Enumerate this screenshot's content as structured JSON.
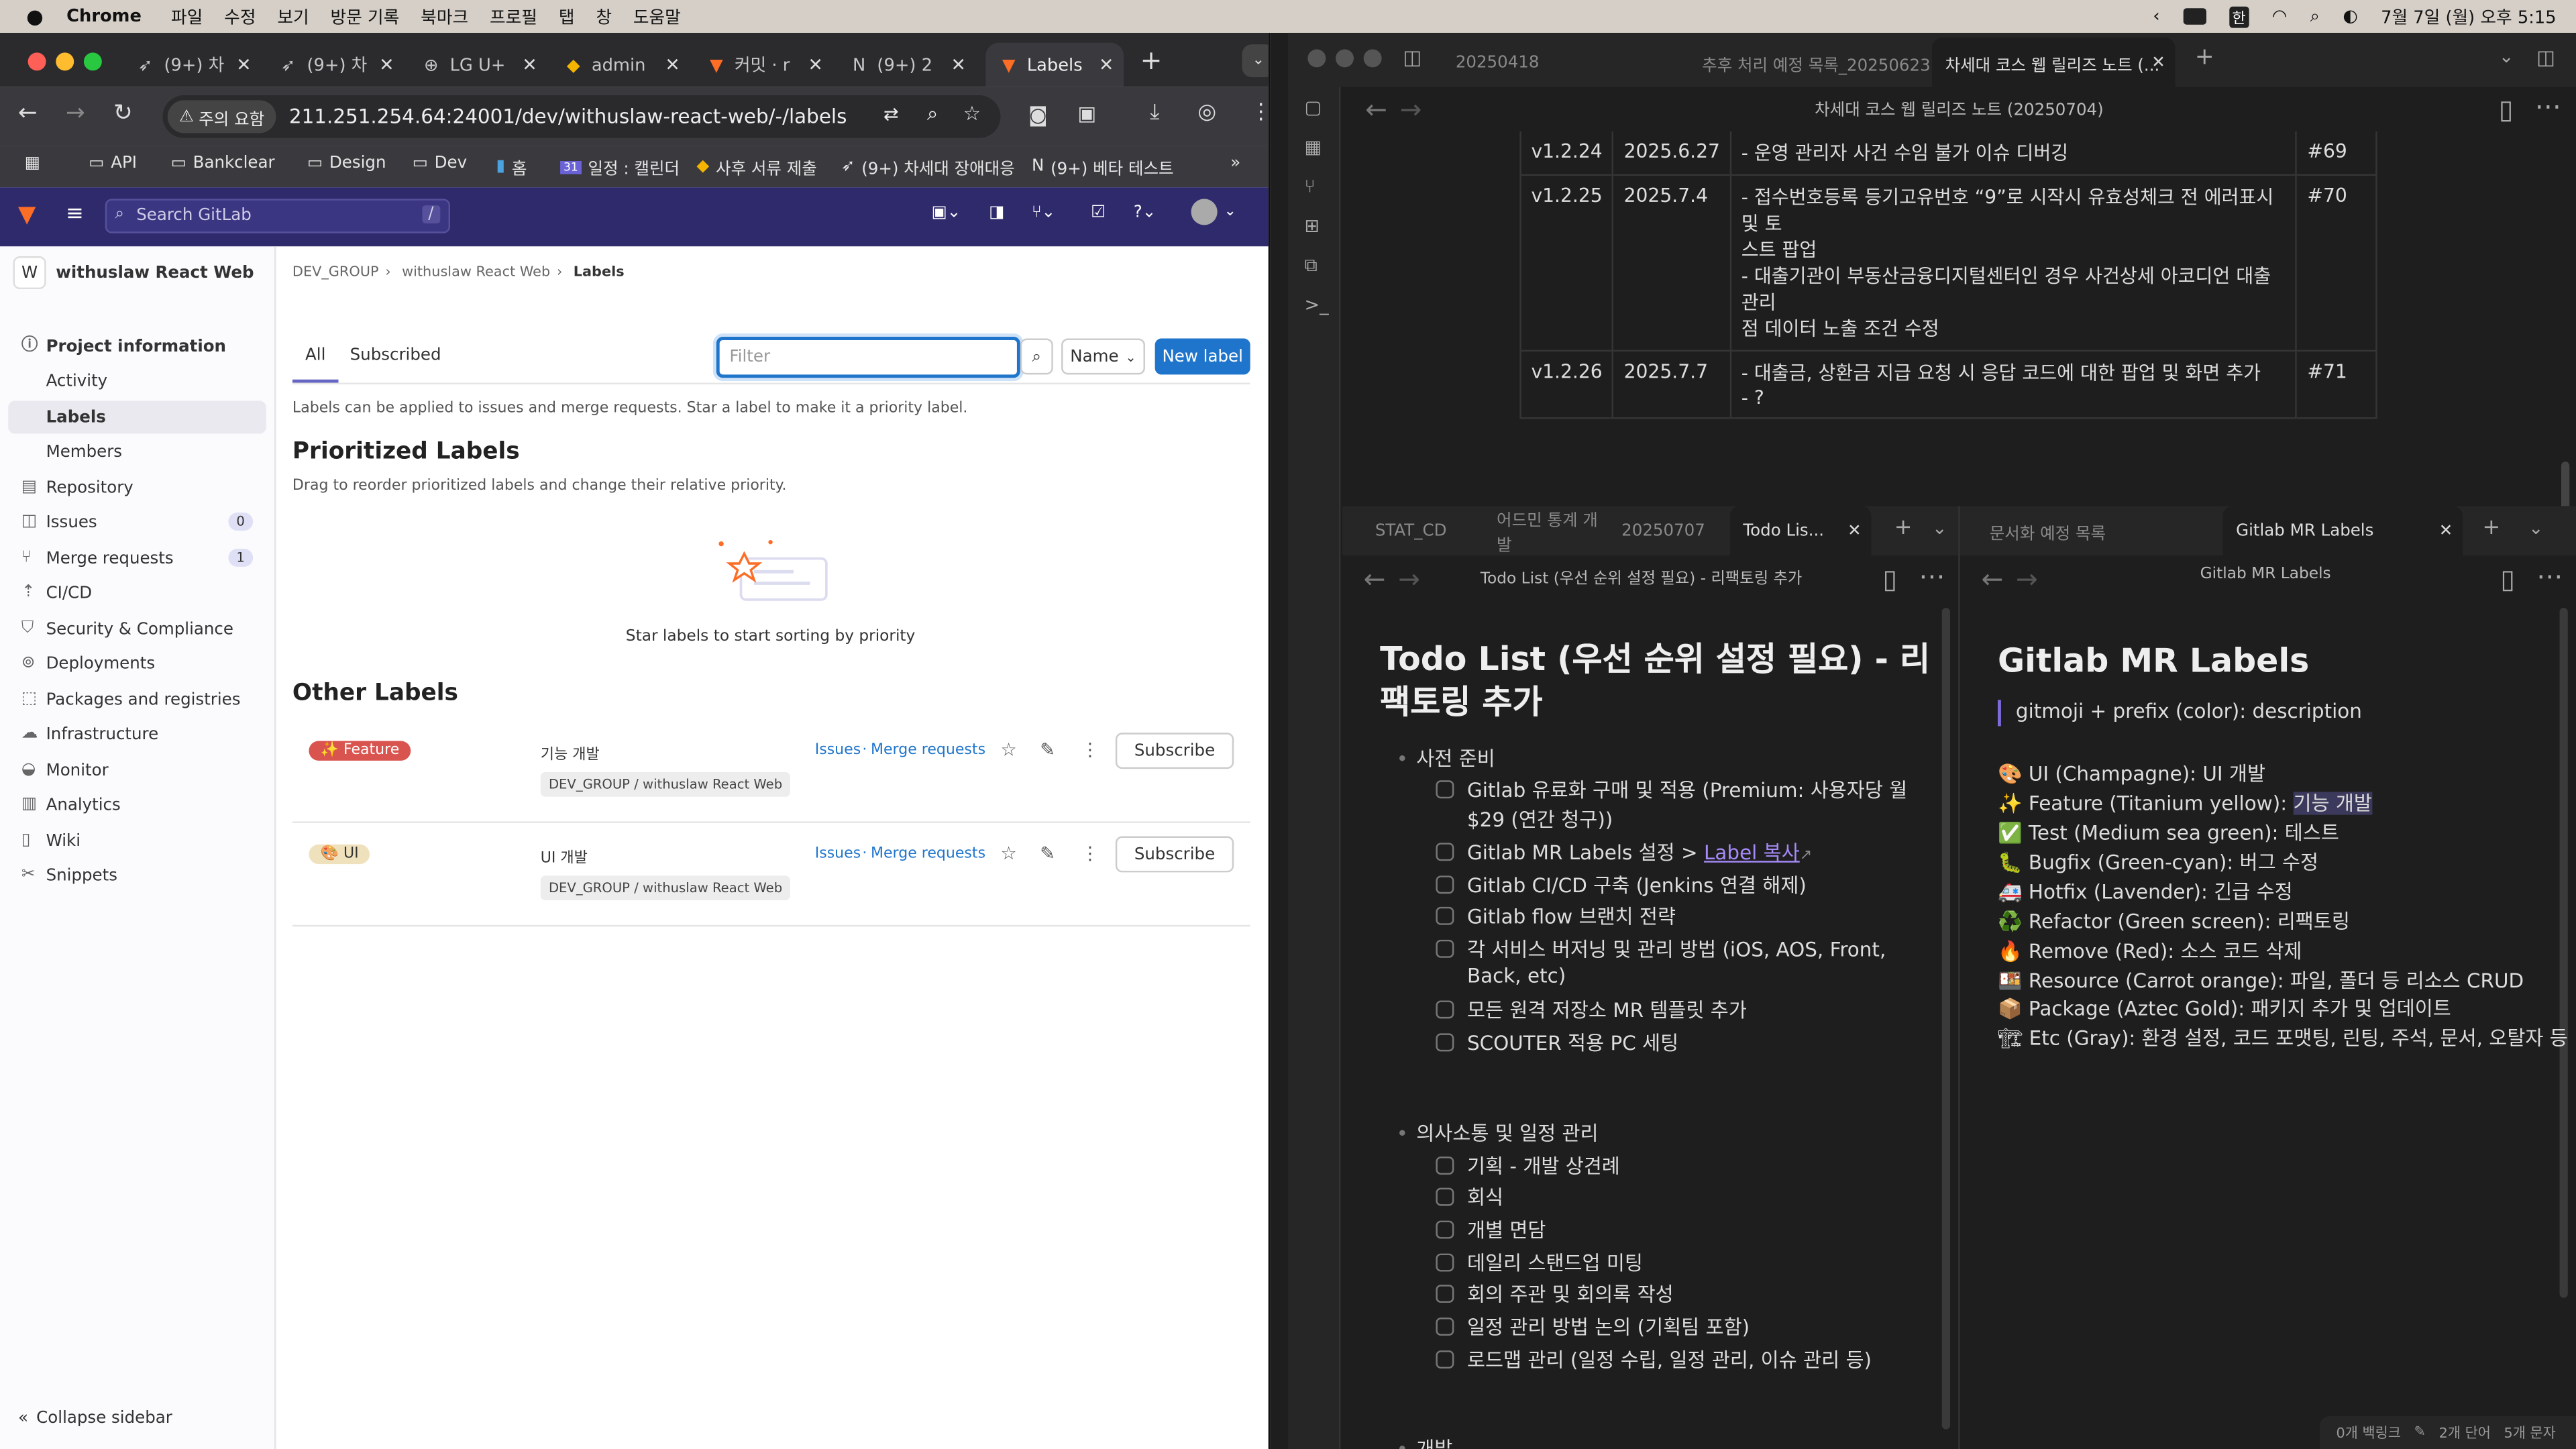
{
  "menubar": {
    "app": "Chrome",
    "items": [
      "파일",
      "수정",
      "보기",
      "방문 기록",
      "북마크",
      "프로필",
      "탭",
      "창",
      "도움말"
    ],
    "clock": "7월 7일 (월) 오후 5:15",
    "input": "한"
  },
  "chrome": {
    "tabs": [
      "(9+) 차",
      "(9+) 차",
      "LG U+",
      "admin",
      "커밋 · r",
      "(9+) 2",
      "Labels"
    ],
    "url": "211.251.254.64:24001/dev/withuslaw-react-web/-/labels",
    "security": "주의 요함",
    "bookmarks": [
      "API",
      "Bankclear",
      "Design",
      "Dev",
      "홈",
      "일정 : 캘린더",
      "사후 서류 제출",
      "(9+) 차세대 장애대응",
      "(9+) 베타 테스트"
    ]
  },
  "gitlab": {
    "search_placeholder": "Search GitLab",
    "search_key": "/",
    "project_initial": "W",
    "project": "withuslaw React Web",
    "nav": [
      {
        "label": "Project information",
        "icon": "info-icon",
        "bold": true
      },
      {
        "label": "Activity"
      },
      {
        "label": "Labels",
        "active": true
      },
      {
        "label": "Members"
      },
      {
        "label": "Repository",
        "icon": "book-icon"
      },
      {
        "label": "Issues",
        "icon": "issues-icon",
        "count": "0"
      },
      {
        "label": "Merge requests",
        "icon": "merge-icon",
        "count": "1"
      },
      {
        "label": "CI/CD",
        "icon": "rocket-icon"
      },
      {
        "label": "Security & Compliance",
        "icon": "shield-icon"
      },
      {
        "label": "Deployments",
        "icon": "deploy-icon"
      },
      {
        "label": "Packages and registries",
        "icon": "package-icon"
      },
      {
        "label": "Infrastructure",
        "icon": "cloud-icon"
      },
      {
        "label": "Monitor",
        "icon": "monitor-icon"
      },
      {
        "label": "Analytics",
        "icon": "chart-icon"
      },
      {
        "label": "Wiki",
        "icon": "wiki-icon"
      },
      {
        "label": "Snippets",
        "icon": "snippet-icon"
      }
    ],
    "collapse": "Collapse sidebar",
    "breadcrumb": [
      "DEV_GROUP",
      "withuslaw React Web",
      "Labels"
    ],
    "tabs": [
      "All",
      "Subscribed"
    ],
    "filter_placeholder": "Filter",
    "sort": "Name",
    "new_label": "New label",
    "intro": "Labels can be applied to issues and merge requests. Star a label to make it a priority label.",
    "prioritized_title": "Prioritized Labels",
    "prioritized_desc": "Drag to reorder prioritized labels and change their relative priority.",
    "empty_text": "Star labels to start sorting by priority",
    "other_title": "Other Labels",
    "labels": [
      {
        "name": "✨ Feature",
        "desc": "기능 개발",
        "group": "DEV_GROUP / withuslaw React Web",
        "color": "#d9534f",
        "text_color": "#ffffff"
      },
      {
        "name": "🎨 UI",
        "desc": "UI 개발",
        "group": "DEV_GROUP / withuslaw React Web",
        "color": "#f0e1bd",
        "text_color": "#333333"
      }
    ],
    "links_issues": "Issues",
    "links_sep": " · ",
    "links_mr": "Merge requests",
    "subscribe": "Subscribe"
  },
  "obsidian": {
    "top_tabs": [
      "20250418",
      "추후 처리 예정 목록_20250623",
      "차세대 코스 웹 릴리즈 노트 (..."
    ],
    "top_title": "차세대 코스 웹 릴리즈 노트 (20250704)",
    "release_rows": [
      {
        "ver": "v1.2.24",
        "date": "2025.6.27",
        "lines": [
          "- 운영 관리자 사건 수임 불가 이슈 디버깅"
        ],
        "ref": "#69"
      },
      {
        "ver": "v1.2.25",
        "date": "2025.7.4",
        "lines": [
          "- 접수번호등록 등기고유번호 “9”로 시작시 유효성체크 전 에러표시 및 토",
          "스트 팝업",
          "- 대출기관이 부동산금융디지털센터인 경우 사건상세 아코디언 대출관리",
          "점 데이터 노출 조건 수정"
        ],
        "ref": "#70"
      },
      {
        "ver": "v1.2.26",
        "date": "2025.7.7",
        "lines": [
          "- 대출금, 상환금 지급 요청 시 응답 코드에 대한 팝업 및 화면 추가",
          "- ?"
        ],
        "ref": "#71"
      }
    ],
    "left_tabs": [
      "STAT_CD",
      "어드민 통계 개발",
      "20250707",
      "Todo Lis..."
    ],
    "left_title": "Todo List (우선 순위 설정 필요) - 리팩토링 추가",
    "todo_h1_line1": "Todo List (우선 순위 설정 필요) - 리",
    "todo_h1_line2": "팩토링 추가",
    "section1": "사전 준비",
    "prep": [
      "Gitlab 유료화 구매 및 적용 (Premium: 사용자당 월",
      "$29 (연간 청구))",
      "Gitlab MR Labels 설정 > ",
      "Label 복사",
      "Gitlab CI/CD 구축 (Jenkins 연결 해제)",
      "Gitlab flow 브랜치 전략",
      "각 서비스 버저닝 및 관리 방법 (iOS, AOS, Front,",
      "Back, etc)",
      "모든 원격 저장소 MR 템플릿 추가",
      "SCOUTER 적용 PC 세팅"
    ],
    "section2": "의사소통 및 일정 관리",
    "comm": [
      "기획 - 개발 상견례",
      "회식",
      "개별 면담",
      "데일리 스탠드업 미팅",
      "회의 주관 및 회의록 작성",
      "일정 관리 방법 논의 (기획팀 포함)",
      "로드맵 관리 (일정 수립, 일정 관리, 이슈 관리 등)"
    ],
    "section3": "개발",
    "right_tabs": [
      "문서화 예정 목록",
      "Gitlab MR Labels"
    ],
    "right_title": "Gitlab MR Labels",
    "mr_h1": "Gitlab MR Labels",
    "mr_quote": "gitmoji + prefix (color): description",
    "mr_items": [
      "🎨 UI (Champagne): UI 개발",
      "✨ Feature (Titanium yellow): ",
      "기능 개발",
      "✅ Test (Medium sea green): 테스트",
      "🐛 Bugfix (Green-cyan): 버그 수정",
      "🚑 Hotfix (Lavender): 긴급 수정",
      "♻️ Refactor (Green screen): 리팩토링",
      "🔥 Remove (Red): 소스 코드 삭제",
      "🍱 Resource (Carrot orange): 파일, 폴더 등 리소스 CRUD",
      "📦 Package (Aztec Gold): 패키지 추가 및 업데이트",
      "🏗 Etc (Gray): 환경 설정, 코드 포맷팅, 린팅, 주석, 문서, 오탈자 등"
    ],
    "status": [
      "0개 백링크",
      "2개 단어",
      "5개 문자"
    ]
  }
}
